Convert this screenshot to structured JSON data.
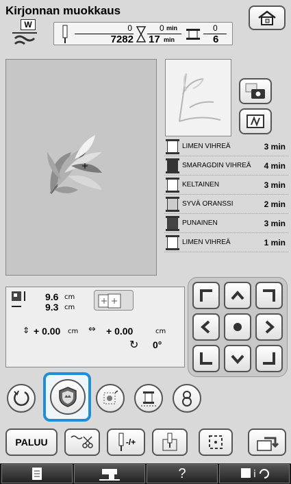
{
  "header": {
    "title": "Kirjonnan muokkaus"
  },
  "status": {
    "presser_foot_letter": "W",
    "stitch_numerator": "0",
    "stitch_total": "7282",
    "time_numerator": "0",
    "time_numerator_unit": "min",
    "time_total": "17",
    "time_total_unit": "min",
    "color_numerator": "0",
    "color_total": "6"
  },
  "threads": [
    {
      "name": "LIMEN VIHREÄ",
      "time": "3 min",
      "color": "#ffffff"
    },
    {
      "name": "SMARAGDIN VIHREÄ",
      "time": "4 min",
      "color": "#333333"
    },
    {
      "name": "KELTAINEN",
      "time": "3 min",
      "color": "#ffffff"
    },
    {
      "name": "SYVÄ ORANSSI",
      "time": "2 min",
      "color": "#cccccc"
    },
    {
      "name": "PUNAINEN",
      "time": "3 min",
      "color": "#444444"
    },
    {
      "name": "LIMEN VIHREÄ",
      "time": "1 min",
      "color": "#ffffff"
    }
  ],
  "size": {
    "height": "9.6",
    "width": "9.3",
    "unit": "cm"
  },
  "position": {
    "vertical": "+ 0.00",
    "horizontal": "+ 0.00",
    "unit": "cm",
    "angle": "0°"
  },
  "buttons": {
    "back_label": "PALUU",
    "density_label": "-/+",
    "help_label": "?"
  },
  "colors": {
    "selected_highlight": "#1e8fd6",
    "background": "#d9d9d9"
  }
}
